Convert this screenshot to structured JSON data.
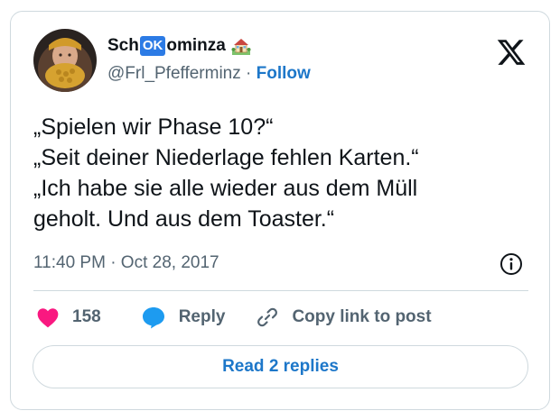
{
  "author": {
    "name_prefix": "Sch",
    "name_badge": "OK",
    "name_suffix": "ominza",
    "name_emoji": "house-with-garden-icon",
    "handle": "@Frl_Pfefferminz",
    "separator": " · ",
    "follow_label": "Follow"
  },
  "tweet": {
    "lines": [
      "„Spielen wir Phase 10?“",
      "„Seit deiner Niederlage fehlen Karten.“",
      "„Ich habe sie alle wieder aus dem Müll",
      "geholt. Und aus dem Toaster.“"
    ],
    "timestamp": "11:40 PM · Oct 28, 2017"
  },
  "actions": {
    "like_count": "158",
    "reply_label": "Reply",
    "copy_link_label": "Copy link to post"
  },
  "read_replies_label": "Read 2 replies",
  "colors": {
    "heart": "#f91880",
    "reply_bubble": "#1d9bf0",
    "link_blue": "#1d77c9",
    "muted": "#536471",
    "border": "#cfd9de"
  }
}
